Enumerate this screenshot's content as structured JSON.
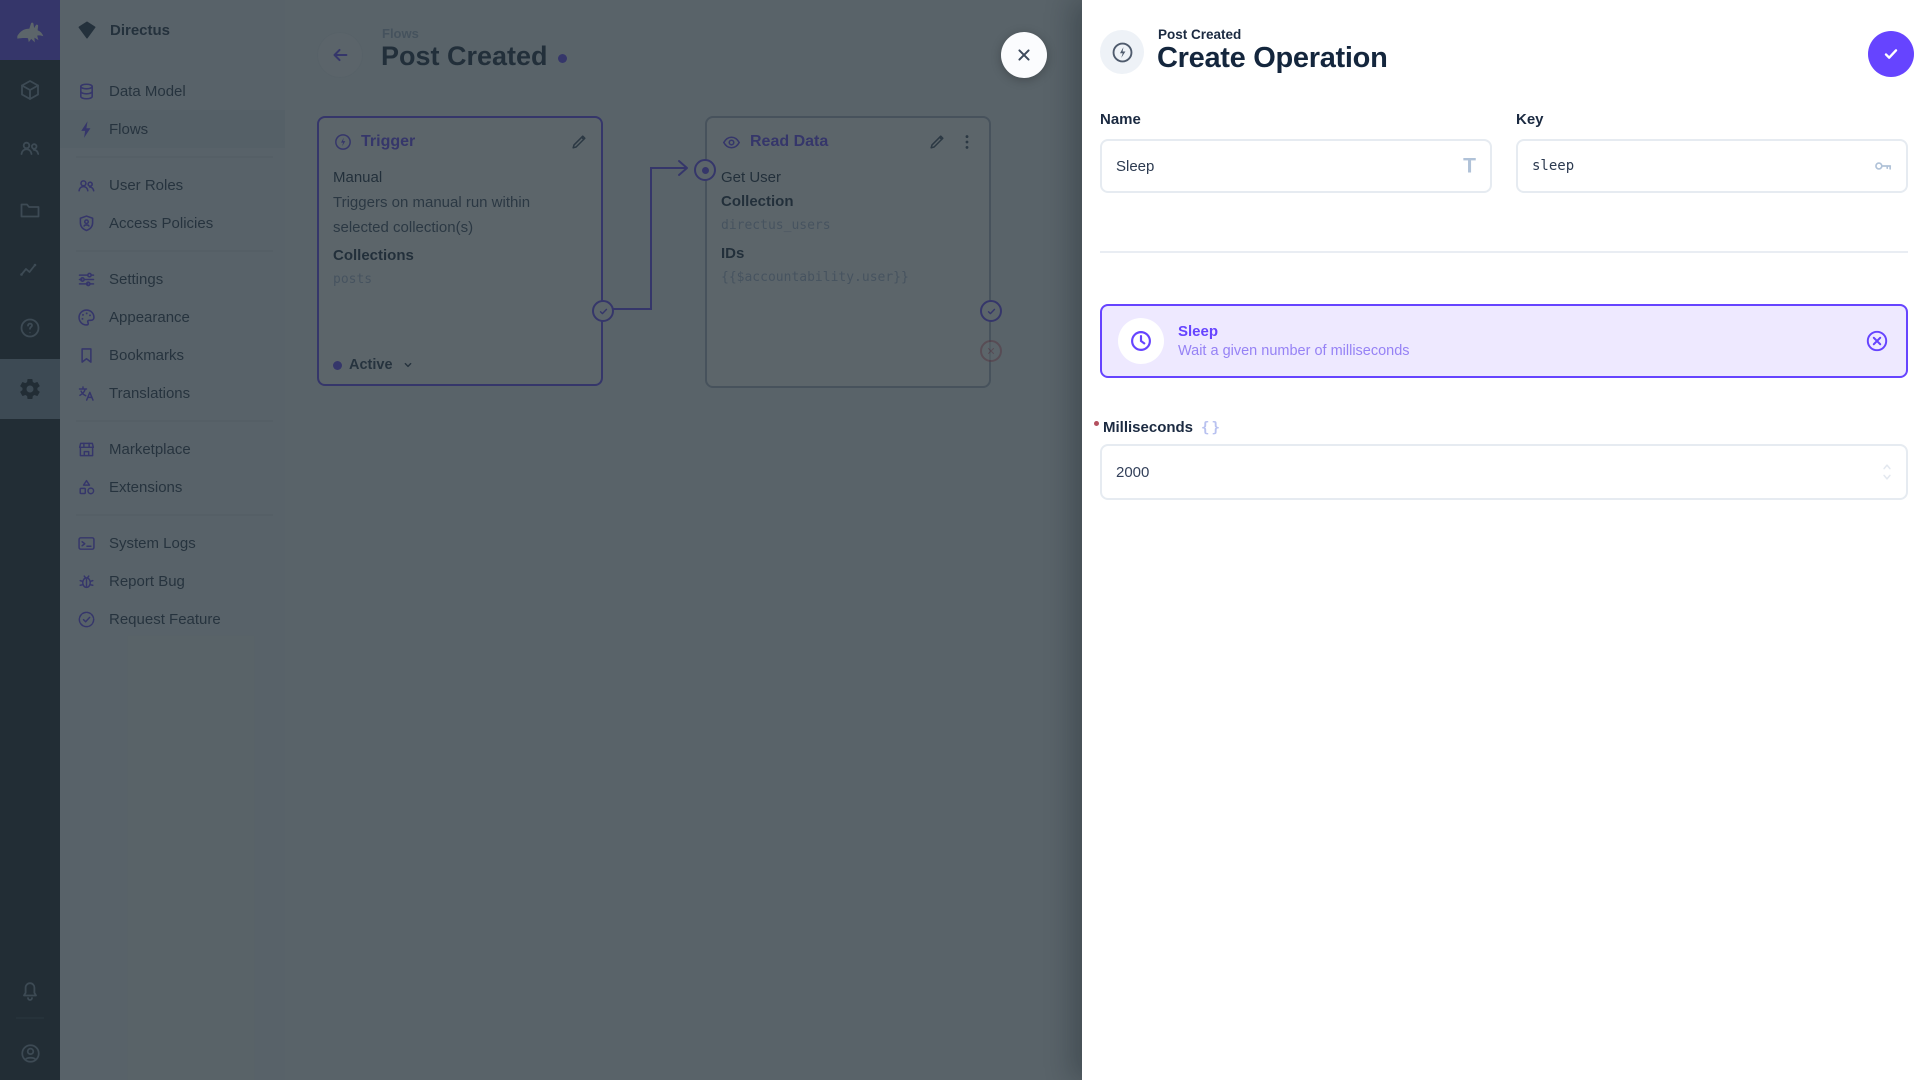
{
  "colors": {
    "primary": "#6644ff",
    "danger": "#e35169",
    "module_bar_bg": "#18222f",
    "nav_bg": "#f0f4f9",
    "overlay": "rgba(38,50,56,0.75)",
    "selected_operation_bg": "#eee9ff"
  },
  "module_bar": {
    "active_module": "settings",
    "modules": [
      "content-module-icon",
      "user-directory-icon",
      "file-library-icon",
      "insights-icon",
      "documentation-icon",
      "settings-icon"
    ],
    "bottom": [
      "notifications-bell-icon",
      "user-avatar-icon"
    ]
  },
  "nav": {
    "project_name": "Directus",
    "items": [
      {
        "label": "Data Model",
        "icon": "database-icon"
      },
      {
        "label": "Flows",
        "icon": "bolt-icon",
        "active": true
      },
      {
        "label": "User Roles",
        "icon": "users-icon"
      },
      {
        "label": "Access Policies",
        "icon": "shield-person-icon"
      },
      {
        "label": "Settings",
        "icon": "tune-icon"
      },
      {
        "label": "Appearance",
        "icon": "palette-icon"
      },
      {
        "label": "Bookmarks",
        "icon": "bookmark-icon"
      },
      {
        "label": "Translations",
        "icon": "translate-icon"
      },
      {
        "label": "Marketplace",
        "icon": "storefront-icon"
      },
      {
        "label": "Extensions",
        "icon": "shapes-icon"
      },
      {
        "label": "System Logs",
        "icon": "terminal-icon"
      },
      {
        "label": "Report Bug",
        "icon": "bug-icon"
      },
      {
        "label": "Request Feature",
        "icon": "seal-check-icon"
      }
    ]
  },
  "canvas": {
    "breadcrumb": "Flows",
    "title": "Post Created",
    "trigger_panel": {
      "header": "Trigger",
      "name": "Manual",
      "description": "Triggers on manual run within selected collection(s)",
      "collections_label": "Collections",
      "collections_value": "posts",
      "status": "Active"
    },
    "operation_panel": {
      "header": "Read Data",
      "name": "Get User",
      "collection_label": "Collection",
      "collection_value": "directus_users",
      "ids_label": "IDs",
      "ids_value": "{{$accountability.user}}"
    }
  },
  "drawer": {
    "breadcrumb": "Post Created",
    "title": "Create Operation",
    "fields": {
      "name_label": "Name",
      "name_value": "Sleep",
      "key_label": "Key",
      "key_value": "sleep",
      "milliseconds_label": "Milliseconds",
      "milliseconds_value": "2000"
    },
    "selected_operation": {
      "name": "Sleep",
      "description": "Wait a given number of milliseconds"
    }
  }
}
